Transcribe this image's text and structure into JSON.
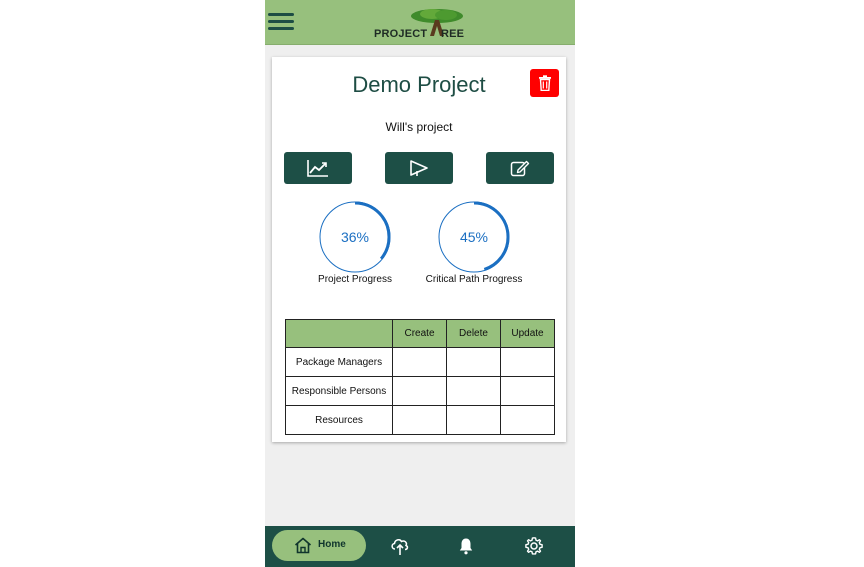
{
  "header": {
    "logo_text_left": "PROJECT",
    "logo_text_right": "REE",
    "menu_icon": "hamburger-menu-icon",
    "brand_color": "#97c07d",
    "dark_color": "#1d4f46"
  },
  "project": {
    "title": "Demo Project",
    "subtitle": "Will's project",
    "delete_icon": "trash-icon",
    "actions": [
      {
        "icon": "chart-icon"
      },
      {
        "icon": "send-icon"
      },
      {
        "icon": "edit-icon"
      }
    ]
  },
  "progress": [
    {
      "label": "Project Progress",
      "value_text": "36%",
      "value": 0.36
    },
    {
      "label": "Critical Path Progress",
      "value_text": "45%",
      "value": 0.45
    }
  ],
  "permissions": {
    "columns": [
      "",
      "Create",
      "Delete",
      "Update"
    ],
    "rows": [
      {
        "label": "Package Managers"
      },
      {
        "label": "Responsible Persons"
      },
      {
        "label": "Resources"
      }
    ]
  },
  "nav": {
    "home_label": "Home",
    "items": [
      "home-icon",
      "tree-upload-icon",
      "bell-icon",
      "settings-icon"
    ]
  }
}
